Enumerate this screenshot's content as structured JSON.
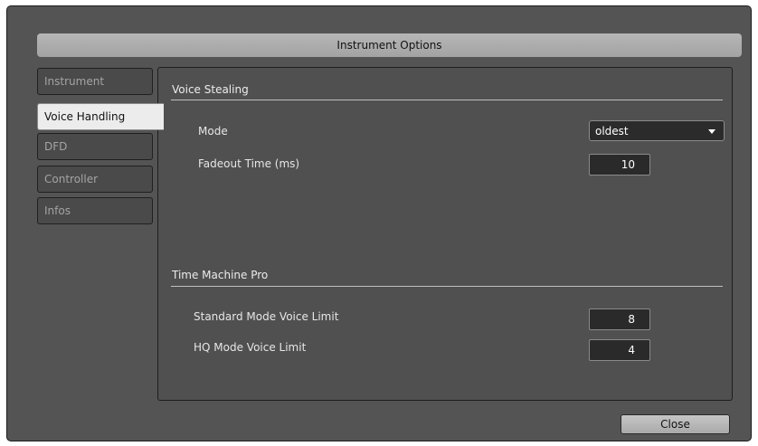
{
  "dialog": {
    "title": "Instrument Options",
    "close_label": "Close"
  },
  "tabs": [
    {
      "label": "Instrument",
      "active": false
    },
    {
      "label": "Voice Handling",
      "active": true
    },
    {
      "label": "DFD",
      "active": false
    },
    {
      "label": "Controller",
      "active": false
    },
    {
      "label": "Infos",
      "active": false
    }
  ],
  "voice_stealing": {
    "title": "Voice Stealing",
    "mode_label": "Mode",
    "mode_value": "oldest",
    "fadeout_label": "Fadeout Time (ms)",
    "fadeout_value": "10"
  },
  "time_machine_pro": {
    "title": "Time Machine Pro",
    "standard_label": "Standard Mode Voice Limit",
    "standard_value": "8",
    "hq_label": "HQ Mode Voice Limit",
    "hq_value": "4"
  },
  "icons": {
    "dropdown_caret": "chevron-down-icon"
  }
}
